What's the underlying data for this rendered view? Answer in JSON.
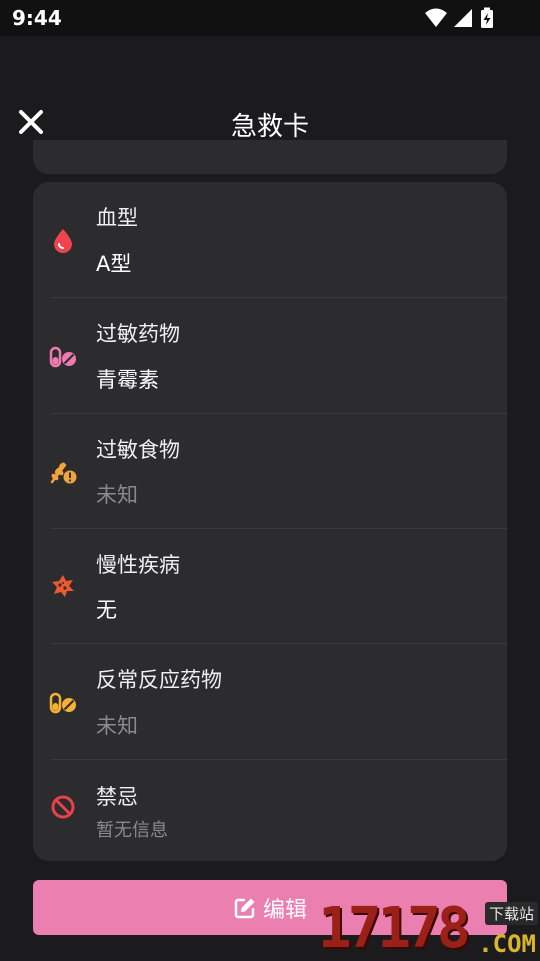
{
  "status_bar": {
    "time": "9:44"
  },
  "header": {
    "title": "急救卡",
    "close_icon": "close-icon"
  },
  "card": {
    "rows": [
      {
        "label": "血型",
        "value": "A型",
        "icon": "blood-drop-icon",
        "value_state": "normal"
      },
      {
        "label": "过敏药物",
        "value": "青霉素",
        "icon": "pills-icon",
        "value_state": "normal"
      },
      {
        "label": "过敏食物",
        "value": "未知",
        "icon": "wheat-warning-icon",
        "value_state": "unknown"
      },
      {
        "label": "慢性疾病",
        "value": "无",
        "icon": "virus-icon",
        "value_state": "normal"
      },
      {
        "label": "反常反应药物",
        "value": "未知",
        "icon": "pills-icon",
        "value_state": "unknown"
      },
      {
        "label": "禁忌",
        "value": "暂无信息",
        "icon": "prohibited-icon",
        "value_state": "placeholder"
      }
    ]
  },
  "edit_button": {
    "label": "编辑",
    "icon": "edit-icon"
  },
  "watermark": {
    "digits": "17178",
    "badge": "下载站",
    "suffix": ".COM"
  },
  "colors": {
    "background": "#1b1b1d",
    "card": "#2c2c2f",
    "accent_pink": "#ea7fb0",
    "blood_red": "#f0434f",
    "pill_pink": "#ee7ab0",
    "food_orange": "#f2a43a",
    "virus_orange": "#ee5a2f",
    "pill_amber": "#f5b133",
    "prohibited_red": "#e8424c"
  }
}
